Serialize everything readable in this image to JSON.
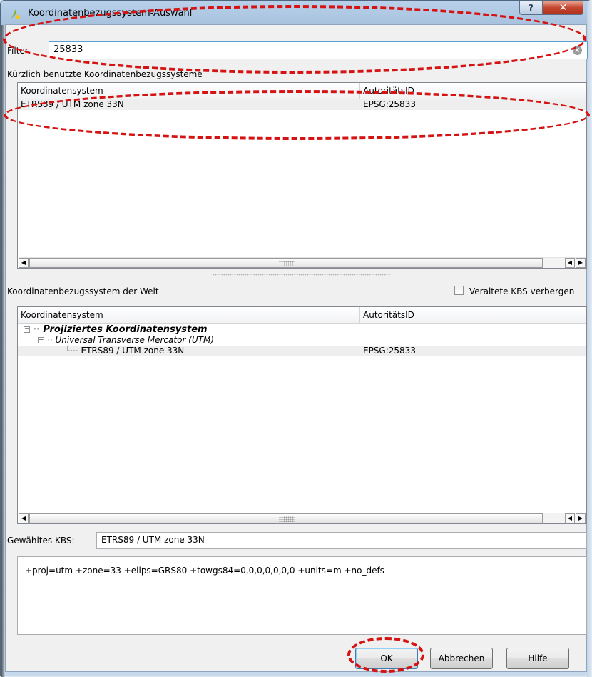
{
  "window": {
    "title": "Koordinatenbezugssystem-Auswahl",
    "help_glyph": "?",
    "close_glyph": "✕"
  },
  "filter": {
    "label": "Filter",
    "value": "25833",
    "clear_glyph": "×"
  },
  "recent": {
    "section_label": "Kürzlich benutzte Koordinatenbezugssysteme",
    "columns": [
      "Koordinatensystem",
      "AutoritätsID"
    ],
    "rows": [
      {
        "name": "ETRS89 / UTM zone 33N",
        "id": "EPSG:25833"
      }
    ]
  },
  "world": {
    "section_label": "Koordinatenbezugssystem der Welt",
    "hide_deprecated_label": "Veraltete KBS verbergen",
    "hide_deprecated_checked": false,
    "columns": [
      "Koordinatensystem",
      "AutoritätsID"
    ],
    "tree": {
      "group": "Projiziertes Koordinatensystem",
      "subgroup": "Universal Transverse Mercator (UTM)",
      "item_name": "ETRS89 / UTM zone 33N",
      "item_id": "EPSG:25833",
      "expanded_glyph": "−"
    }
  },
  "selected": {
    "label": "Gewähltes KBS:",
    "value": "ETRS89 / UTM zone 33N",
    "proj_string": "+proj=utm +zone=33 +ellps=GRS80 +towgs84=0,0,0,0,0,0,0 +units=m +no_defs"
  },
  "scroll_glyphs": {
    "left": "◀",
    "right": "▶"
  },
  "buttons": {
    "ok": "OK",
    "cancel": "Abbrechen",
    "help": "Hilfe"
  },
  "colors": {
    "highlight": "#d51313",
    "selection": "#eeeeee"
  }
}
